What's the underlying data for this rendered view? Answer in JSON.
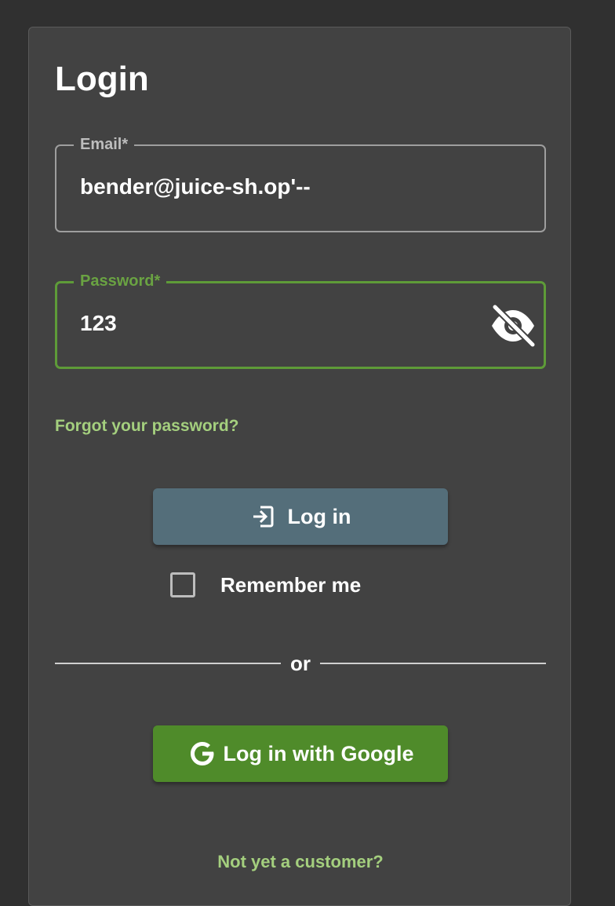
{
  "login": {
    "title": "Login",
    "email": {
      "label": "Email*",
      "value": "bender@juice-sh.op'--"
    },
    "password": {
      "label": "Password*",
      "value": "123",
      "toggle_icon": "eye-off-icon"
    },
    "forgot_link": "Forgot your password?",
    "login_button": {
      "label": "Log in",
      "icon": "login-icon"
    },
    "remember_me": {
      "label": "Remember me",
      "checked": false
    },
    "divider_text": "or",
    "google_button": {
      "label": "Log in with Google",
      "icon": "google-icon"
    },
    "register_link": "Not yet a customer?"
  },
  "colors": {
    "background": "#303030",
    "card": "#424242",
    "accent_green": "#5e9b38",
    "link_green": "#a4cf7e",
    "login_button": "#546e7a",
    "google_button": "#4f8b2a"
  }
}
